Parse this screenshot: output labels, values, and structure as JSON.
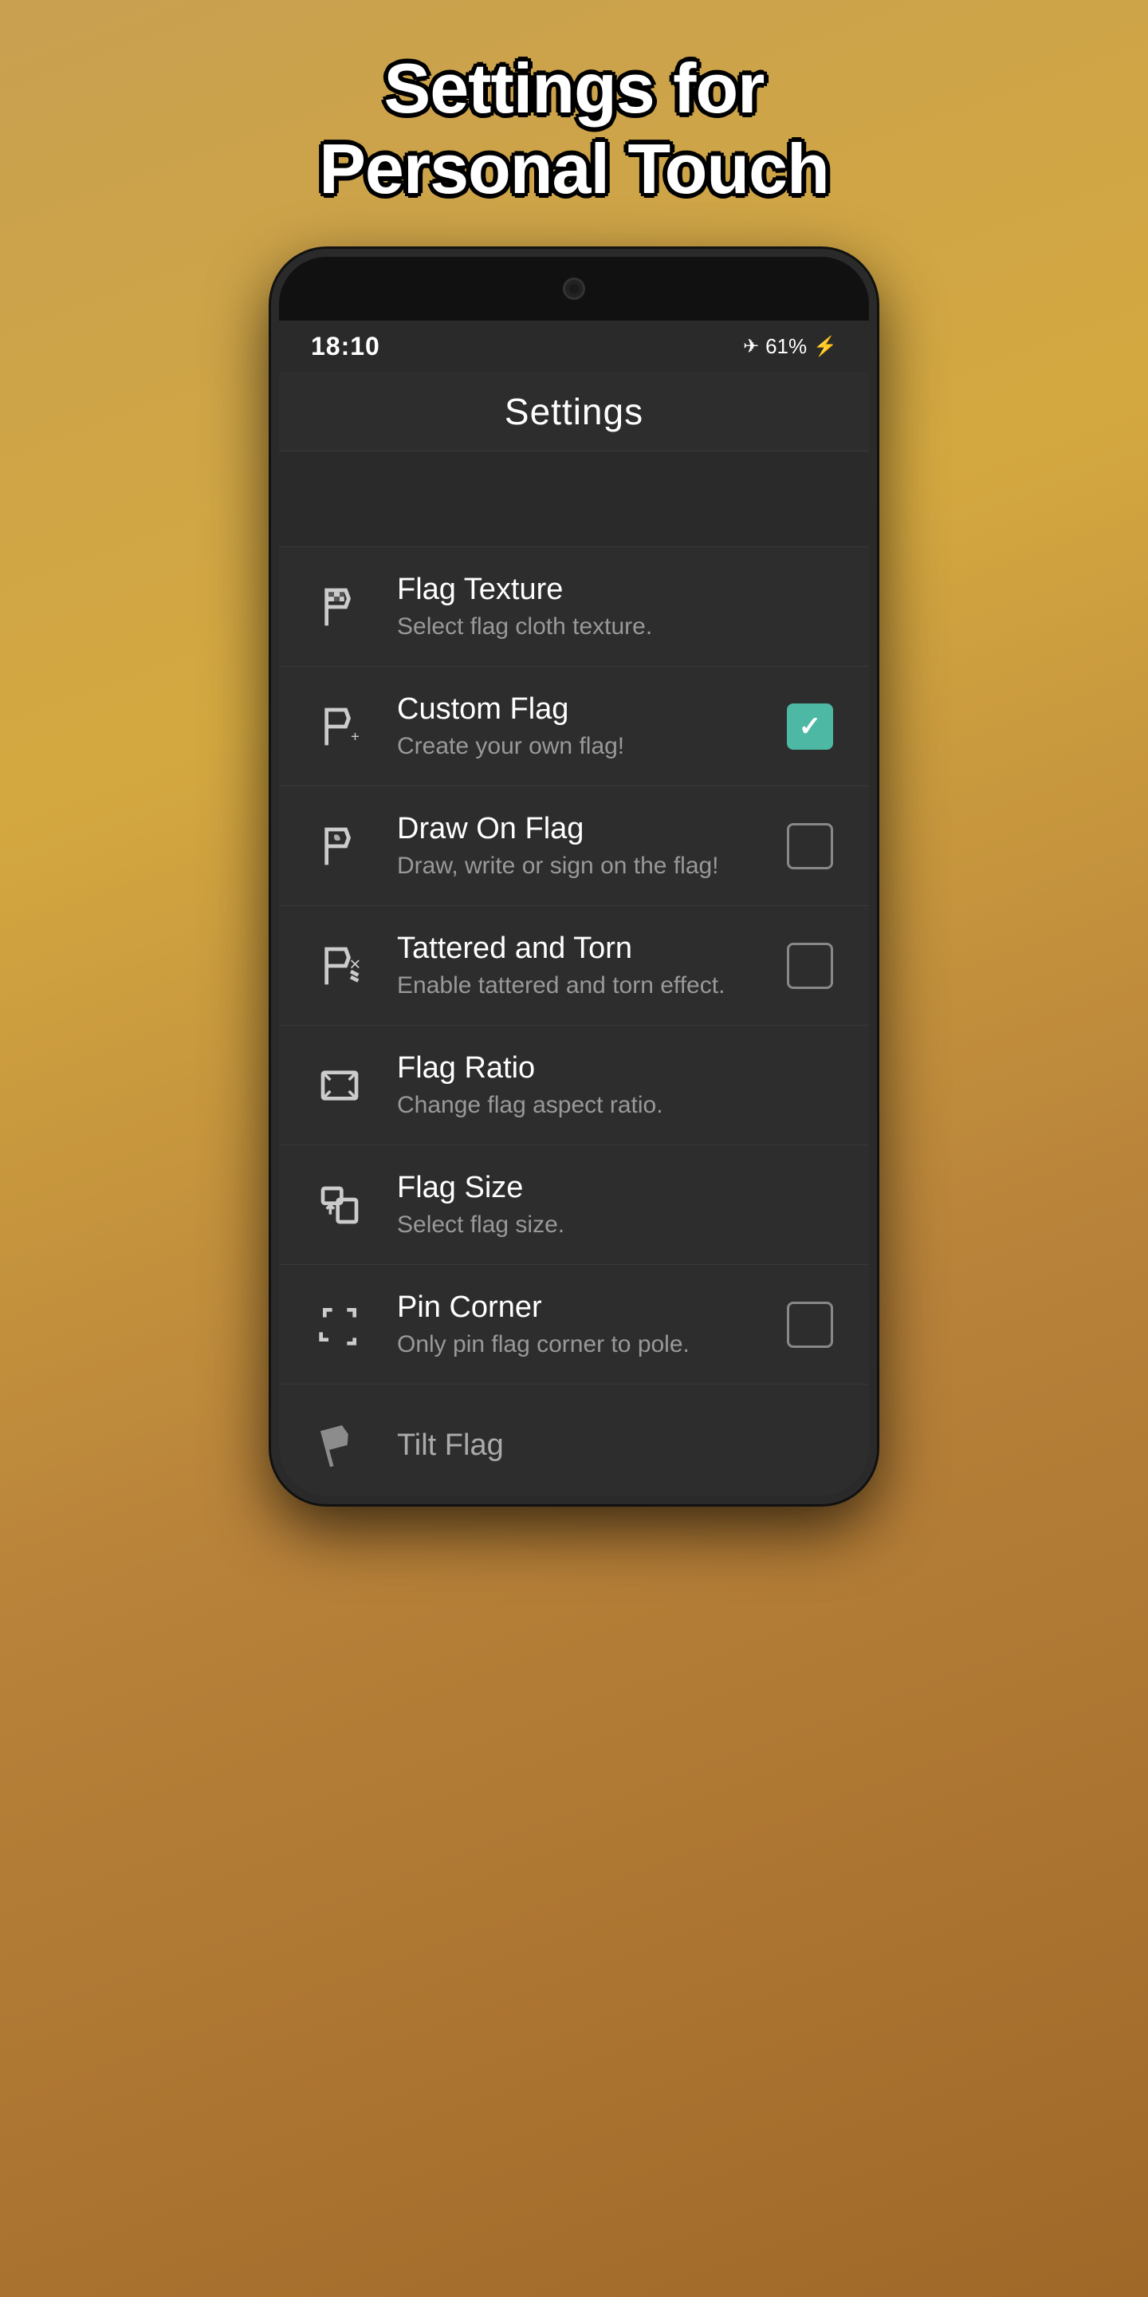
{
  "page": {
    "title_line1": "Settings for",
    "title_line2": "Personal Touch"
  },
  "status_bar": {
    "time": "18:10",
    "battery": "61%",
    "icons": "✈"
  },
  "app_header": {
    "title": "Settings"
  },
  "settings_items": [
    {
      "id": "flag-texture",
      "title": "Flag Texture",
      "subtitle": "Select flag cloth texture.",
      "has_checkbox": false,
      "checked": false
    },
    {
      "id": "custom-flag",
      "title": "Custom Flag",
      "subtitle": "Create your own flag!",
      "has_checkbox": true,
      "checked": true
    },
    {
      "id": "draw-on-flag",
      "title": "Draw On Flag",
      "subtitle": "Draw, write or sign on the flag!",
      "has_checkbox": true,
      "checked": false
    },
    {
      "id": "tattered-and-torn",
      "title": "Tattered and Torn",
      "subtitle": "Enable tattered and torn effect.",
      "has_checkbox": true,
      "checked": false
    },
    {
      "id": "flag-ratio",
      "title": "Flag Ratio",
      "subtitle": "Change flag aspect ratio.",
      "has_checkbox": false,
      "checked": false
    },
    {
      "id": "flag-size",
      "title": "Flag Size",
      "subtitle": "Select flag size.",
      "has_checkbox": false,
      "checked": false
    },
    {
      "id": "pin-corner",
      "title": "Pin Corner",
      "subtitle": "Only pin flag corner to pole.",
      "has_checkbox": true,
      "checked": false
    },
    {
      "id": "tilt-flag",
      "title": "Tilt Flag",
      "subtitle": "",
      "has_checkbox": false,
      "checked": false
    }
  ]
}
